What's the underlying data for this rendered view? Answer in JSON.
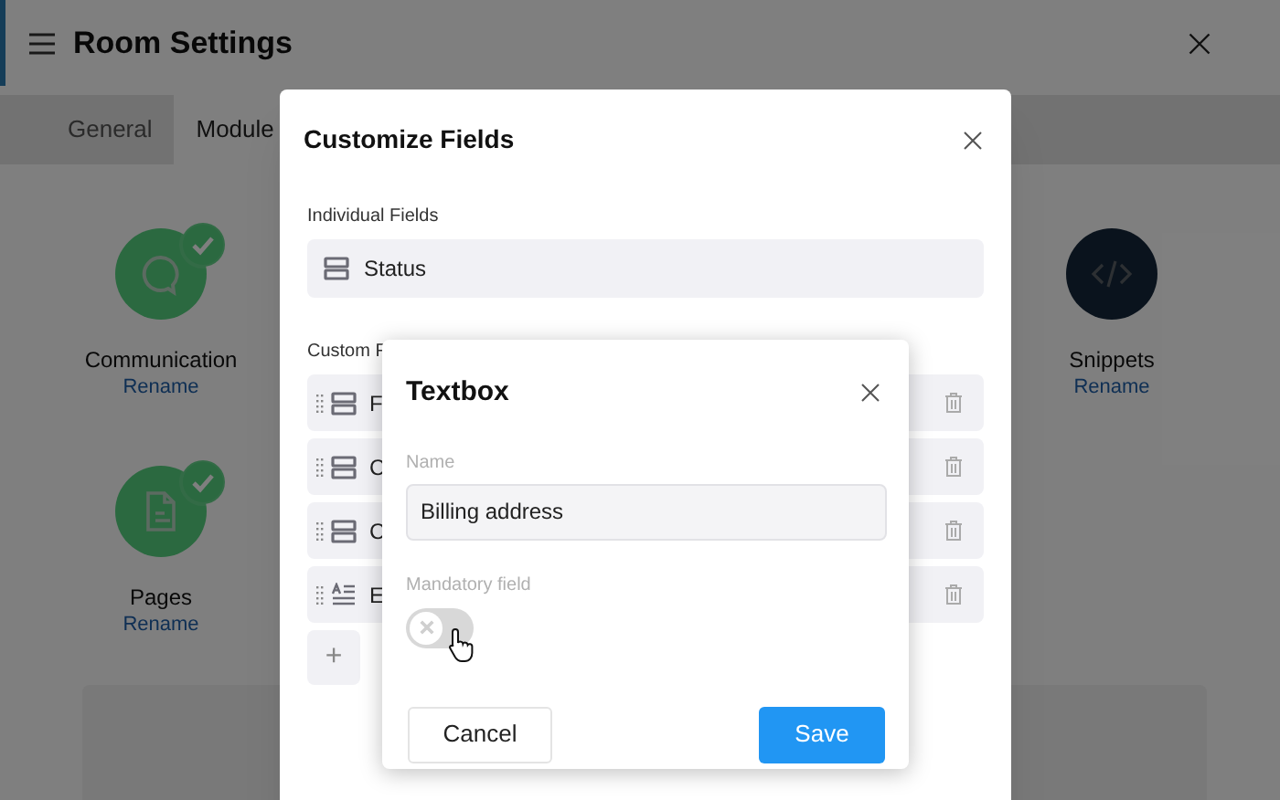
{
  "page": {
    "title": "Room Settings",
    "tabs": [
      {
        "label": "General",
        "selected": false
      },
      {
        "label": "Module",
        "selected": true
      }
    ],
    "module_rows": [
      [
        {
          "name": "Communication",
          "action": "Rename",
          "kind": "chat",
          "enabled": true
        },
        {
          "name": "Snippets",
          "action": "Rename",
          "kind": "code",
          "enabled": false
        }
      ],
      [
        {
          "name": "Pages",
          "action": "Rename",
          "kind": "page",
          "enabled": true
        }
      ]
    ]
  },
  "customize_dialog": {
    "title": "Customize Fields",
    "individual_label": "Individual Fields",
    "individual_fields": [
      {
        "label": "Status",
        "kind": "select"
      }
    ],
    "custom_label": "Custom F",
    "custom_fields": [
      {
        "label": "F",
        "kind": "select"
      },
      {
        "label": "C",
        "kind": "select"
      },
      {
        "label": "C",
        "kind": "select"
      },
      {
        "label": "E",
        "kind": "text"
      }
    ],
    "add": "+"
  },
  "textbox_dialog": {
    "title": "Textbox",
    "name_label": "Name",
    "name_value": "Billing address",
    "mandatory_label": "Mandatory field",
    "mandatory_on": false,
    "buttons": [
      {
        "label": "Cancel",
        "kind": "secondary"
      },
      {
        "label": "Save",
        "kind": "primary"
      }
    ]
  }
}
